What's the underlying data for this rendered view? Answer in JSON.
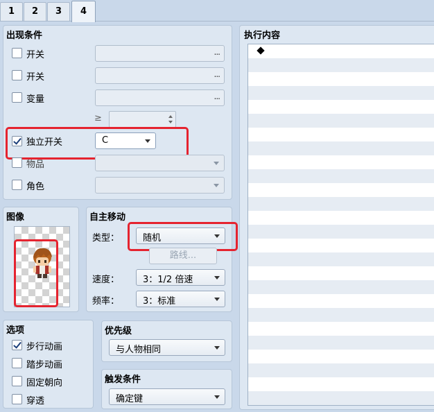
{
  "tabs": [
    {
      "label": "1"
    },
    {
      "label": "2"
    },
    {
      "label": "3"
    },
    {
      "label": "4"
    }
  ],
  "active_tab": "4",
  "conditions": {
    "title": "出现条件",
    "switch1": {
      "label": "开关",
      "checked": false,
      "button": "..."
    },
    "switch2": {
      "label": "开关",
      "checked": false,
      "button": "..."
    },
    "variable": {
      "label": "变量",
      "checked": false,
      "button": "..."
    },
    "variable_op": "≥",
    "self_switch": {
      "label": "独立开关",
      "checked": true,
      "value": "C"
    },
    "item": {
      "label": "物品",
      "checked": false
    },
    "actor": {
      "label": "角色",
      "checked": false
    }
  },
  "image": {
    "title": "图像",
    "sprite": "character-sprite"
  },
  "autonomous": {
    "title": "自主移动",
    "type_label": "类型：",
    "type_value": "随机",
    "route_button": "路线...",
    "speed_label": "速度：",
    "speed_value": "3：1/2 倍速",
    "freq_label": "频率：",
    "freq_value": "3：标准"
  },
  "options": {
    "title": "选项",
    "walking": {
      "label": "步行动画",
      "checked": true
    },
    "stepping": {
      "label": "踏步动画",
      "checked": false
    },
    "direction_fix": {
      "label": "固定朝向",
      "checked": false
    },
    "through": {
      "label": "穿透",
      "checked": false
    }
  },
  "priority": {
    "title": "优先级",
    "value": "与人物相同"
  },
  "trigger": {
    "title": "触发条件",
    "value": "确定键"
  },
  "contents": {
    "title": "执行内容",
    "first_row_symbol": "◆"
  },
  "colors": {
    "highlight_box": "#e5232f",
    "panel_bg": "#dde7f2"
  }
}
